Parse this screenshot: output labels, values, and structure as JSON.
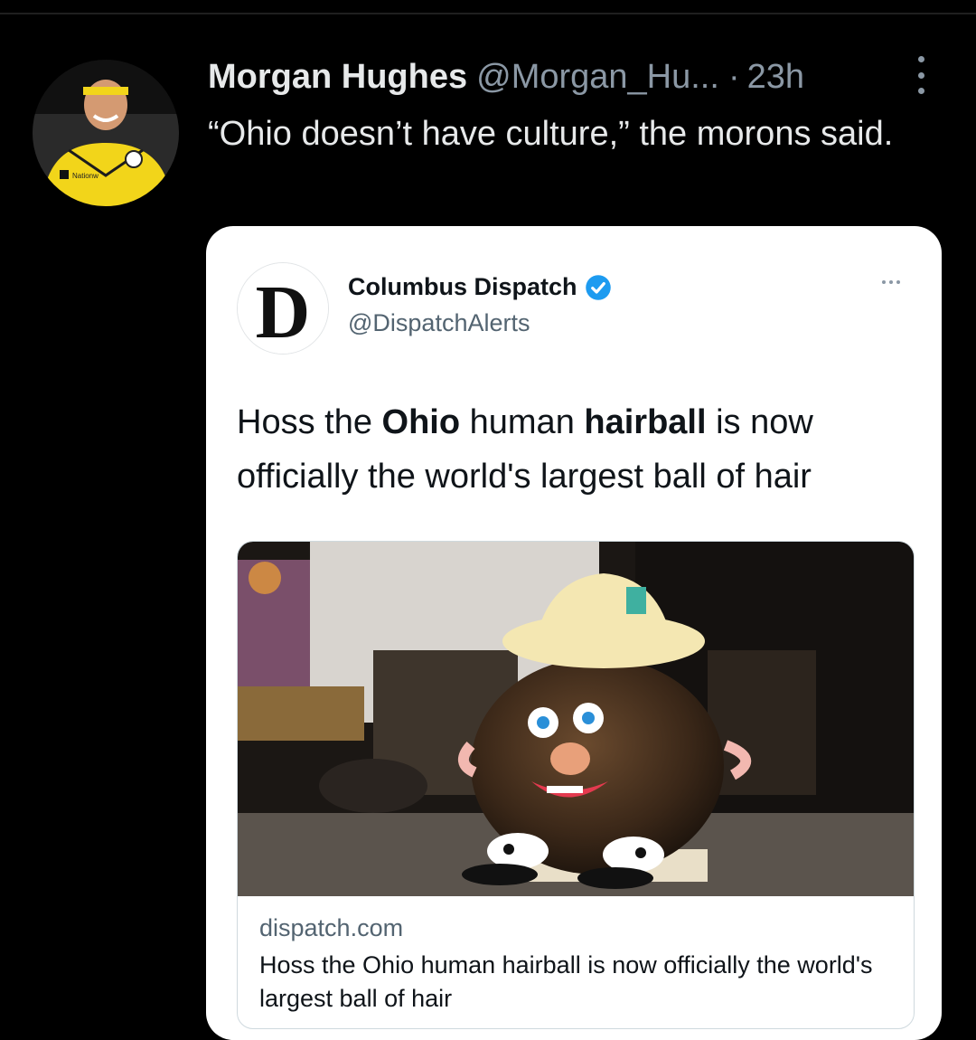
{
  "tweet": {
    "author_name": "Morgan Hughes",
    "author_handle": "@Morgan_Hu...",
    "separator": "·",
    "timestamp": "23h",
    "text": "“Ohio doesn’t have culture,” the morons said.",
    "avatar_icon": "profile-photo",
    "avatar_text": "Nationw"
  },
  "quoted": {
    "author_name": "Columbus Dispatch",
    "author_handle": "@DispatchAlerts",
    "verified": true,
    "logo_letter": "D",
    "text_parts": [
      "Hoss the ",
      "Ohio",
      " human ",
      "hairball",
      " is now officially the world's largest ball of hair"
    ],
    "link_card": {
      "domain": "dispatch.com",
      "title": "Hoss the Ohio human hairball is now officially the world's largest ball of hair",
      "image_icon": "hairball-photo"
    }
  },
  "colors": {
    "background": "#000000",
    "primary_text": "#e7e9ea",
    "secondary_text": "#8b98a5",
    "card_background": "#ffffff",
    "verified_blue": "#1d9bf0"
  }
}
